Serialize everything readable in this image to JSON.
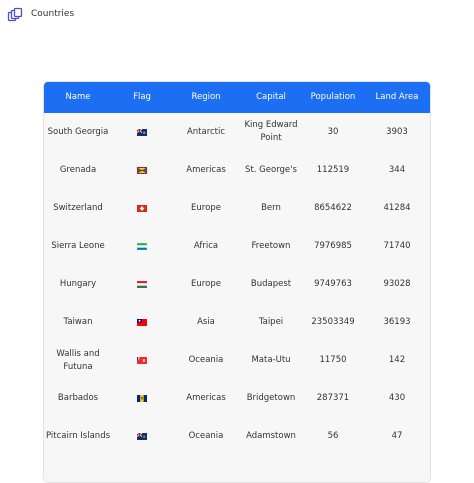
{
  "header": {
    "title": "Countries",
    "logo_icon": "layers-icon"
  },
  "table": {
    "header_color": "#1c6ef2",
    "columns": [
      "Name",
      "Flag",
      "Region",
      "Capital",
      "Population",
      "Land Area"
    ],
    "rows": [
      {
        "name": [
          "South Georgia"
        ],
        "flag": "gs",
        "region": "Antarctic",
        "capital": [
          "King Edward",
          "Point"
        ],
        "population": "30",
        "area": "3903"
      },
      {
        "name": [
          "Grenada"
        ],
        "flag": "gd",
        "region": "Americas",
        "capital": [
          "St. George's"
        ],
        "population": "112519",
        "area": "344"
      },
      {
        "name": [
          "Switzerland"
        ],
        "flag": "ch",
        "region": "Europe",
        "capital": [
          "Bern"
        ],
        "population": "8654622",
        "area": "41284"
      },
      {
        "name": [
          "Sierra Leone"
        ],
        "flag": "sl",
        "region": "Africa",
        "capital": [
          "Freetown"
        ],
        "population": "7976985",
        "area": "71740"
      },
      {
        "name": [
          "Hungary"
        ],
        "flag": "hu",
        "region": "Europe",
        "capital": [
          "Budapest"
        ],
        "population": "9749763",
        "area": "93028"
      },
      {
        "name": [
          "Taiwan"
        ],
        "flag": "tw",
        "region": "Asia",
        "capital": [
          "Taipei"
        ],
        "population": "23503349",
        "area": "36193"
      },
      {
        "name": [
          "Wallis and",
          "Futuna"
        ],
        "flag": "wf",
        "region": "Oceania",
        "capital": [
          "Mata-Utu"
        ],
        "population": "11750",
        "area": "142"
      },
      {
        "name": [
          "Barbados"
        ],
        "flag": "bb",
        "region": "Americas",
        "capital": [
          "Bridgetown"
        ],
        "population": "287371",
        "area": "430"
      },
      {
        "name": [
          "Pitcairn Islands"
        ],
        "flag": "pn",
        "region": "Oceania",
        "capital": [
          "Adamstown"
        ],
        "population": "56",
        "area": "47"
      }
    ]
  }
}
